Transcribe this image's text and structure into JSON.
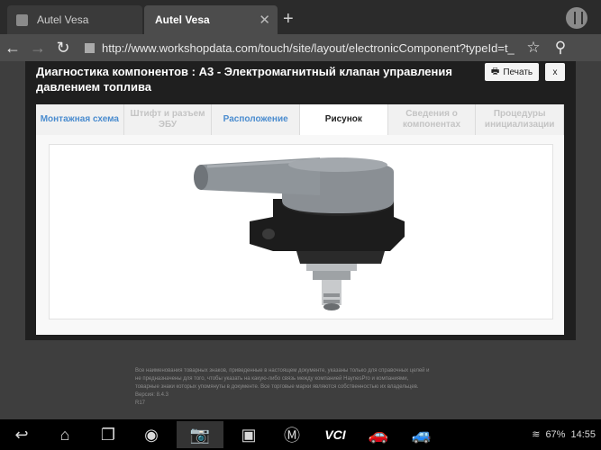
{
  "browser": {
    "tabs": [
      {
        "label": "Autel Vesa"
      },
      {
        "label": "Autel Vesa"
      }
    ],
    "new_tab_glyph": "+",
    "url": "http://www.workshopdata.com/touch/site/layout/electronicComponent?typeId=t_"
  },
  "modal": {
    "title": "Диагностика компонентов : A3 - Электромагнитный клапан управления давлением топлива",
    "print_label": "Печать",
    "close_label": "x",
    "tabs": [
      {
        "label": "Монтажная схема",
        "state": "link"
      },
      {
        "label": "Штифт и разъем ЭБУ",
        "state": "disabled"
      },
      {
        "label": "Расположение",
        "state": "link"
      },
      {
        "label": "Рисунок",
        "state": "active"
      },
      {
        "label": "Сведения о компонентах",
        "state": "disabled"
      },
      {
        "label": "Процедуры инициализации",
        "state": "disabled"
      }
    ]
  },
  "footer": {
    "line1": "Все наименования товарных знаков, приведенные в настоящем документе, указаны только для справочных целей и",
    "line2": "не предназначены для того, чтобы указать на какую-либо связь между компанией HaynesPro и компаниями,",
    "line3": "товарные знаки которых упомянуты в документе. Все торговые марки являются собственностью их владельцев.",
    "line4": "Версия: 8.4.3",
    "line5": "R17"
  },
  "system": {
    "vci_label": "VCI",
    "battery": "67%",
    "time": "14:55"
  },
  "colors": {
    "tab_link": "#4a8ccf",
    "tab_disabled": "#c4c4c4"
  }
}
